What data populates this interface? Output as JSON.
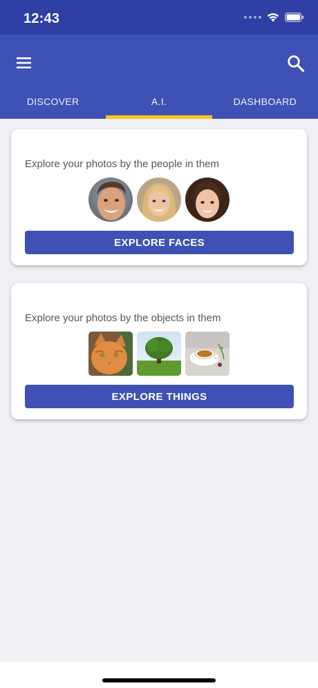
{
  "status_bar": {
    "time": "12:43"
  },
  "tabs": [
    {
      "label": "DISCOVER",
      "active": false
    },
    {
      "label": "A.I.",
      "active": true
    },
    {
      "label": "DASHBOARD",
      "active": false
    }
  ],
  "cards": {
    "faces": {
      "text": "Explore your photos by the people in them",
      "button": "EXPLORE FACES",
      "thumbnails": [
        "man-face-photo",
        "blonde-woman-face-photo",
        "girl-face-photo"
      ]
    },
    "things": {
      "text": "Explore your photos by the objects in them",
      "button": "EXPLORE THINGS",
      "thumbnails": [
        "orange-cat-photo",
        "tree-on-meadow-photo",
        "teacup-photo"
      ]
    }
  },
  "colors": {
    "primary": "#3f51b5",
    "status_bar": "#2f3fa3",
    "tab_indicator": "#f7c51a",
    "background": "#efeff4"
  }
}
